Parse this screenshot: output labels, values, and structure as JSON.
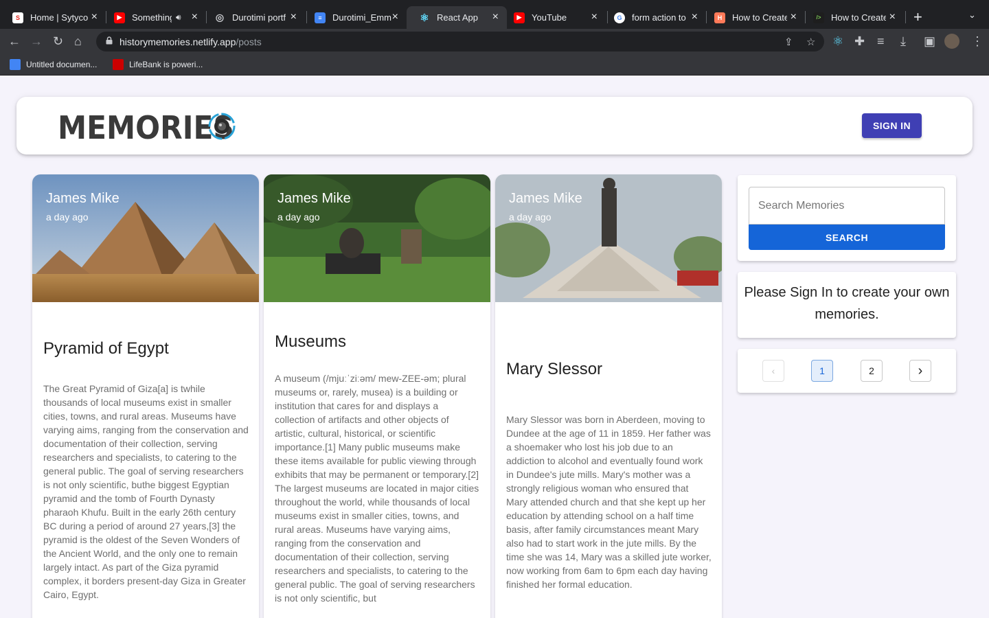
{
  "browser": {
    "tabs": [
      {
        "title": "Home | Sytyco",
        "fav_color": "#ffffff",
        "fav_glyph": "S"
      },
      {
        "title": "Something",
        "fav_color": "#ff0000",
        "fav_glyph": "▶"
      },
      {
        "title": "Durotimi portf",
        "fav_color": "#9aa0a6",
        "fav_glyph": "◎"
      },
      {
        "title": "Durotimi_Emm",
        "fav_color": "#4285f4",
        "fav_glyph": "≡"
      },
      {
        "title": "React App",
        "fav_color": "#35363a",
        "fav_glyph": "⚛"
      },
      {
        "title": "YouTube",
        "fav_color": "#ff0000",
        "fav_glyph": "▶"
      },
      {
        "title": "form action to",
        "fav_color": "#ffffff",
        "fav_glyph": "G"
      },
      {
        "title": "How to Create",
        "fav_color": "#ff7a59",
        "fav_glyph": "H"
      },
      {
        "title": "How to Create",
        "fav_color": "#1e1e1e",
        "fav_glyph": "/>"
      }
    ],
    "url_host": "historymemories.netlify.app",
    "url_path": "/posts",
    "bookmarks": [
      {
        "label": "Untitled documen...",
        "color": "#4285f4"
      },
      {
        "label": "LifeBank is poweri...",
        "color": "#cc0000"
      }
    ]
  },
  "header": {
    "brand": "MEMORIES",
    "signin_label": "SIGN IN"
  },
  "posts": [
    {
      "author": "James Mike",
      "time": "a day ago",
      "title": "Pyramid of Egypt",
      "body": "The Great Pyramid of Giza[a] is twhile thousands of local museums exist in smaller cities, towns, and rural areas. Museums have varying aims, ranging from the conservation and documentation of their collection, serving researchers and specialists, to catering to the general public. The goal of serving researchers is not only scientific, buthe biggest Egyptian pyramid and the tomb of Fourth Dynasty pharaoh Khufu. Built in the early 26th century BC during a period of around 27 years,[3] the pyramid is the oldest of the Seven Wonders of the Ancient World, and the only one to remain largely intact. As part of the Giza pyramid complex, it borders present-day Giza in Greater Cairo, Egypt."
    },
    {
      "author": "James Mike",
      "time": "a day ago",
      "title": "Museums",
      "body": "A museum (/mjuːˈziːəm/ mew-ZEE-əm; plural museums or, rarely, musea) is a building or institution that cares for and displays a collection of artifacts and other objects of artistic, cultural, historical, or scientific importance.[1] Many public museums make these items available for public viewing through exhibits that may be permanent or temporary.[2] The largest museums are located in major cities throughout the world, while thousands of local museums exist in smaller cities, towns, and rural areas. Museums have varying aims, ranging from the conservation and documentation of their collection, serving researchers and specialists, to catering to the general public. The goal of serving researchers is not only scientific, but"
    },
    {
      "author": "James Mike",
      "time": "a day ago",
      "title": "Mary Slessor",
      "body": "Mary Slessor was born in Aberdeen, moving to Dundee at the age of 11 in 1859. Her father was a shoemaker who lost his job due to an addiction to alcohol and eventually found work in Dundee's jute mills. Mary's mother was a strongly religious woman who ensured that Mary attended church and that she kept up her education by attending school on a half time basis, after family circumstances meant Mary also had to start work in the jute mills. By the time she was 14, Mary was a skilled jute worker, now working from 6am to 6pm each day having finished her formal education."
    }
  ],
  "sidebar": {
    "search_placeholder": "Search Memories",
    "search_label": "SEARCH",
    "signin_message": "Please Sign In to create your own memories.",
    "pages": [
      "1",
      "2"
    ],
    "current_page": "1"
  }
}
